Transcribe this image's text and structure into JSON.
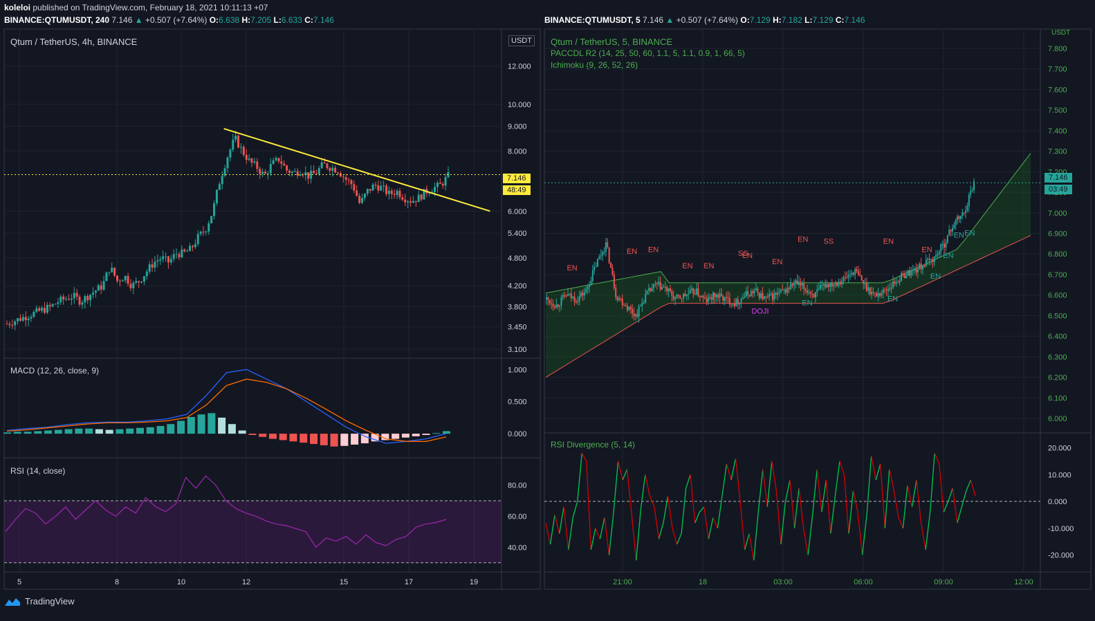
{
  "header": {
    "author": "koleloi",
    "published": "published on TradingView.com, February 18, 2021 10:11:13 +07",
    "left_symbol": "BINANCE:QTUMUSDT, 240",
    "right_symbol": "BINANCE:QTUMUSDT, 5",
    "price": "7.146",
    "change_arrow": "▲",
    "change": "+0.507 (+7.64%)",
    "left_ohlc": {
      "o": "6.638",
      "h": "7.205",
      "l": "6.633",
      "c": "7.146"
    },
    "right_ohlc": {
      "o": "7.129",
      "h": "7.182",
      "l": "7.129",
      "c": "7.146"
    }
  },
  "left_panel": {
    "title": "Qtum / TetherUS, 4h, BINANCE",
    "currency_badge": "USDT",
    "price_tag": "7.146",
    "countdown": "48:49",
    "macd_title": "MACD (12, 26, close, 9)",
    "rsi_title": "RSI (14, close)"
  },
  "right_panel": {
    "title": "Qtum / TetherUS, 5, BINANCE",
    "ind1": "PACCDL R2 (14, 25, 50, 60, 1.1, 5, 1.1, 0.9, 1, 66, 5)",
    "ind2": "Ichimoku (9, 26, 52, 26)",
    "currency_badge": "USDT",
    "price_tag": "7.146",
    "countdown": "03:49",
    "rsi_div_title": "RSI Divergence (5, 14)"
  },
  "footer": {
    "brand": "TradingView"
  },
  "colors": {
    "up": "#26a69a",
    "down": "#ef5350",
    "trendline": "#ffeb3b",
    "rsi": "#9c27b0",
    "macd": "#2962ff",
    "signal": "#ff6d00"
  },
  "chart_data": [
    {
      "type": "candlestick",
      "title": "Qtum / TetherUS, 4h, BINANCE",
      "scale": "log",
      "ylim": [
        3.0,
        13.5
      ],
      "y_ticks": [
        "3.100",
        "3.450",
        "3.800",
        "4.200",
        "4.800",
        "5.400",
        "6.000",
        "7.146",
        "8.000",
        "9.000",
        "10.000",
        "12.000"
      ],
      "x_ticks": [
        "5",
        "8",
        "10",
        "12",
        "15",
        "17",
        "19"
      ],
      "close_path": [
        3.5,
        3.55,
        3.6,
        3.65,
        3.7,
        3.75,
        3.8,
        3.9,
        3.95,
        4.0,
        3.9,
        4.0,
        4.1,
        4.2,
        4.6,
        4.3,
        4.4,
        4.2,
        4.3,
        4.5,
        4.7,
        4.8,
        4.7,
        4.9,
        4.9,
        5.0,
        5.3,
        5.5,
        6.0,
        7.0,
        7.8,
        8.5,
        8.0,
        7.6,
        7.4,
        7.1,
        7.5,
        7.7,
        7.3,
        7.2,
        7.3,
        7.1,
        7.2,
        7.5,
        7.4,
        7.3,
        7.0,
        6.8,
        6.2,
        6.6,
        6.8,
        6.7,
        6.5,
        6.6,
        6.4,
        6.3,
        6.4,
        6.6,
        6.7,
        6.8,
        7.1
      ],
      "trendline": [
        [
          11.3,
          8.9
        ],
        [
          19.5,
          6.0
        ]
      ],
      "last_price": 7.146
    },
    {
      "type": "bar",
      "title": "MACD (12, 26, close, 9)",
      "ylim": [
        -0.3,
        1.1
      ],
      "y_ticks": [
        "0.000",
        "0.500",
        "1.000"
      ],
      "histogram": [
        0.02,
        0.03,
        0.03,
        0.04,
        0.05,
        0.06,
        0.07,
        0.08,
        0.08,
        0.07,
        0.06,
        0.07,
        0.08,
        0.09,
        0.1,
        0.12,
        0.15,
        0.2,
        0.26,
        0.3,
        0.32,
        0.25,
        0.15,
        0.05,
        -0.02,
        -0.05,
        -0.08,
        -0.1,
        -0.12,
        -0.14,
        -0.16,
        -0.18,
        -0.2,
        -0.19,
        -0.17,
        -0.15,
        -0.12,
        -0.1,
        -0.08,
        -0.06,
        -0.04,
        -0.02,
        0.01,
        0.04
      ],
      "macd_line": [
        0.05,
        0.08,
        0.1,
        0.14,
        0.17,
        0.18,
        0.18,
        0.2,
        0.23,
        0.3,
        0.6,
        0.95,
        1.0,
        0.85,
        0.7,
        0.5,
        0.3,
        0.1,
        -0.05,
        -0.15,
        -0.12,
        -0.08,
        0.0
      ],
      "signal_line": [
        0.04,
        0.06,
        0.09,
        0.12,
        0.15,
        0.17,
        0.17,
        0.18,
        0.2,
        0.25,
        0.45,
        0.75,
        0.85,
        0.8,
        0.7,
        0.55,
        0.38,
        0.2,
        0.05,
        -0.08,
        -0.12,
        -0.12,
        -0.05
      ]
    },
    {
      "type": "line",
      "title": "RSI (14, close)",
      "ylim": [
        25,
        95
      ],
      "y_ticks": [
        "40.00",
        "60.00",
        "80.00"
      ],
      "levels": [
        70,
        30
      ],
      "values": [
        50,
        58,
        65,
        62,
        55,
        60,
        66,
        58,
        64,
        70,
        64,
        60,
        66,
        62,
        72,
        66,
        63,
        68,
        85,
        78,
        86,
        80,
        70,
        65,
        62,
        60,
        57,
        55,
        54,
        52,
        50,
        40,
        46,
        44,
        47,
        42,
        48,
        43,
        41,
        45,
        47,
        53,
        55,
        56,
        58
      ]
    },
    {
      "type": "candlestick",
      "title": "Qtum / TetherUS, 5, BINANCE",
      "ylim": [
        5.95,
        7.85
      ],
      "y_ticks": [
        "6.000",
        "6.100",
        "6.200",
        "6.300",
        "6.400",
        "6.500",
        "6.600",
        "6.700",
        "6.800",
        "6.900",
        "7.000",
        "7.100",
        "7.146",
        "7.200",
        "7.300",
        "7.400",
        "7.500",
        "7.600",
        "7.700",
        "7.800"
      ],
      "x_ticks": [
        "21:00",
        "18",
        "03:00",
        "06:00",
        "09:00",
        "12:00"
      ],
      "close_path": [
        6.58,
        6.55,
        6.6,
        6.58,
        6.62,
        6.75,
        6.85,
        6.6,
        6.55,
        6.5,
        6.6,
        6.65,
        6.63,
        6.58,
        6.6,
        6.62,
        6.57,
        6.6,
        6.58,
        6.56,
        6.6,
        6.62,
        6.58,
        6.6,
        6.62,
        6.66,
        6.63,
        6.6,
        6.65,
        6.66,
        6.68,
        6.72,
        6.65,
        6.6,
        6.62,
        6.66,
        6.7,
        6.72,
        6.75,
        6.78,
        6.85,
        6.95,
        7.0,
        7.15
      ],
      "signals": [
        {
          "text": "EN",
          "color": "#ef5350",
          "x": 0.06,
          "y": 6.72
        },
        {
          "text": "EN",
          "color": "#ef5350",
          "x": 0.2,
          "y": 6.8
        },
        {
          "text": "EN",
          "color": "#ef5350",
          "x": 0.25,
          "y": 6.81
        },
        {
          "text": "EN",
          "color": "#ef5350",
          "x": 0.33,
          "y": 6.73
        },
        {
          "text": "EN",
          "color": "#ef5350",
          "x": 0.38,
          "y": 6.73
        },
        {
          "text": "SS",
          "color": "#ef5350",
          "x": 0.46,
          "y": 6.79
        },
        {
          "text": "EN",
          "color": "#ef5350",
          "x": 0.47,
          "y": 6.78
        },
        {
          "text": "DOJI",
          "color": "#e040fb",
          "x": 0.5,
          "y": 6.51
        },
        {
          "text": "EN",
          "color": "#ef5350",
          "x": 0.54,
          "y": 6.75
        },
        {
          "text": "EN",
          "color": "#ef5350",
          "x": 0.6,
          "y": 6.86
        },
        {
          "text": "EN",
          "color": "#26a69a",
          "x": 0.61,
          "y": 6.55
        },
        {
          "text": "SS",
          "color": "#ef5350",
          "x": 0.66,
          "y": 6.85
        },
        {
          "text": "EN",
          "color": "#ef5350",
          "x": 0.8,
          "y": 6.85
        },
        {
          "text": "EN",
          "color": "#26a69a",
          "x": 0.81,
          "y": 6.57
        },
        {
          "text": "EN",
          "color": "#ef5350",
          "x": 0.89,
          "y": 6.81
        },
        {
          "text": "EN",
          "color": "#26a69a",
          "x": 0.91,
          "y": 6.68
        },
        {
          "text": "EN",
          "color": "#26a69a",
          "x": 0.94,
          "y": 6.78
        },
        {
          "text": "EN",
          "color": "#26a69a",
          "x": 0.965,
          "y": 6.88
        },
        {
          "text": "EN",
          "color": "#26a69a",
          "x": 0.99,
          "y": 6.89
        }
      ],
      "last_price": 7.146
    },
    {
      "type": "line",
      "title": "RSI Divergence (5, 14)",
      "ylim": [
        -25,
        24
      ],
      "y_ticks": [
        "-20.000",
        "-10.000",
        "0.000",
        "10.000",
        "20.000"
      ],
      "values": [
        -8,
        -16,
        -5,
        -12,
        -2,
        -18,
        -6,
        0,
        18,
        15,
        -18,
        -10,
        -14,
        -6,
        -20,
        -4,
        15,
        8,
        12,
        -5,
        -22,
        -3,
        10,
        2,
        -2,
        -14,
        -8,
        2,
        -10,
        -16,
        -12,
        5,
        10,
        -8,
        -4,
        -2,
        -14,
        -6,
        -10,
        2,
        14,
        8,
        16,
        0,
        -18,
        -12,
        -22,
        -4,
        12,
        -2,
        15,
        4,
        -16,
        0,
        8,
        -10,
        5,
        -10,
        -20,
        -5,
        12,
        -4,
        8,
        -12,
        2,
        15,
        10,
        -12,
        4,
        -4,
        -20,
        -5,
        17,
        8,
        14,
        -10,
        12,
        4,
        -6,
        -10,
        6,
        -2,
        8,
        -8,
        -18,
        -4,
        18,
        14,
        -4,
        0,
        5,
        -8,
        -2,
        4,
        8,
        2
      ]
    }
  ]
}
